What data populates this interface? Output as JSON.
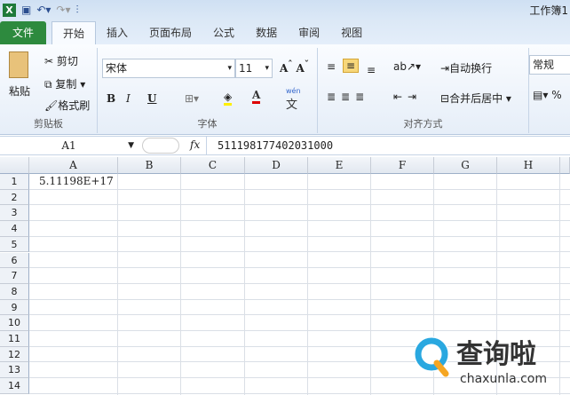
{
  "window": {
    "title": "工作簿1",
    "quick_access": [
      "save-icon",
      "undo-icon",
      "redo-icon",
      "customize-icon"
    ]
  },
  "tabs": [
    {
      "label": "文件"
    },
    {
      "label": "开始"
    },
    {
      "label": "插入"
    },
    {
      "label": "页面布局"
    },
    {
      "label": "公式"
    },
    {
      "label": "数据"
    },
    {
      "label": "审阅"
    },
    {
      "label": "视图"
    }
  ],
  "clipboard": {
    "paste": "粘贴",
    "cut": "剪切",
    "copy": "复制",
    "format_painter": "格式刷",
    "label": "剪贴板"
  },
  "font": {
    "name": "宋体",
    "size": "11",
    "bold": "B",
    "italic": "I",
    "underline": "U",
    "label": "字体",
    "wen": "wén"
  },
  "alignment": {
    "wrap": "自动换行",
    "merge": "合并后居中",
    "label": "对齐方式"
  },
  "number": {
    "format": "常规",
    "percent": "%"
  },
  "formula_bar": {
    "name_box": "A1",
    "fx": "fx",
    "value": "511198177402031000"
  },
  "columns": [
    "A",
    "B",
    "C",
    "D",
    "E",
    "F",
    "G",
    "H"
  ],
  "rows": [
    "1",
    "2",
    "3",
    "4",
    "5",
    "6",
    "7",
    "8",
    "9",
    "10",
    "11",
    "12",
    "13",
    "14"
  ],
  "cells": {
    "A1": "5.11198E+17"
  },
  "watermark": {
    "brand": "查询啦",
    "url": "chaxunla.com"
  },
  "colors": {
    "file_tab": "#2d8a3e",
    "accent": "#f0c040"
  }
}
